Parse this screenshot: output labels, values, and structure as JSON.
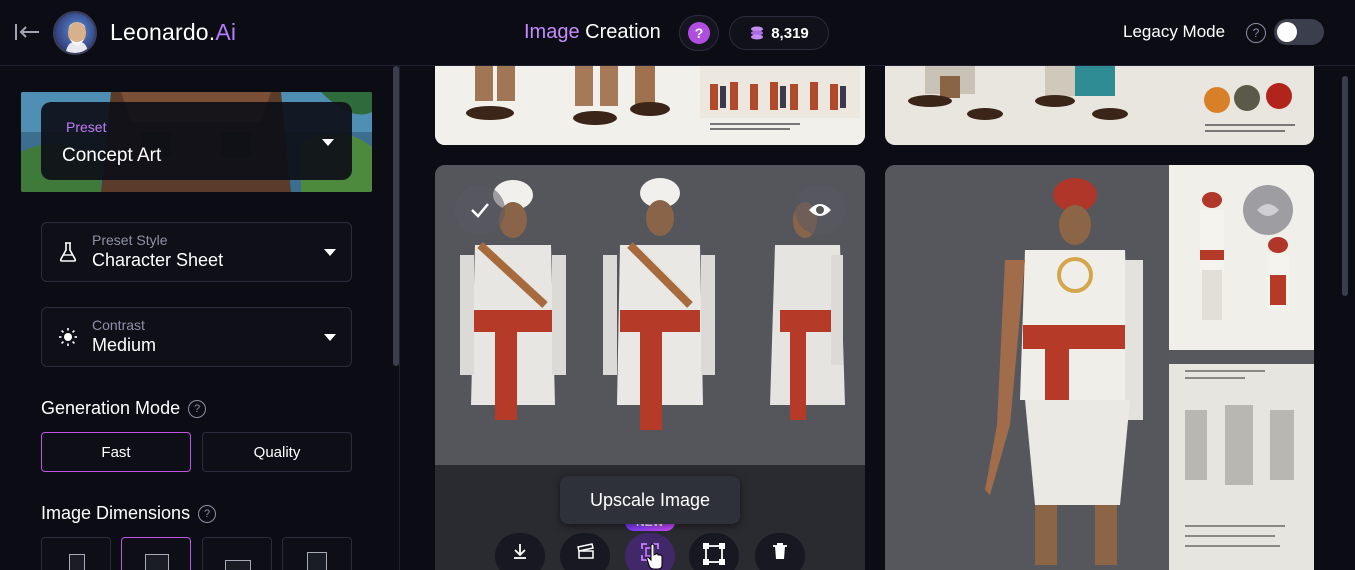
{
  "header": {
    "brand_name": "Leonardo.",
    "brand_suffix": "Ai",
    "page_title_prefix": "Image",
    "page_title_main": "Creation",
    "help_label": "?",
    "token_count": "8,319",
    "legacy_mode_label": "Legacy Mode",
    "legacy_mode_enabled": false,
    "legacy_help": "?"
  },
  "sidebar": {
    "preset": {
      "label": "Preset",
      "value": "Concept Art"
    },
    "preset_style": {
      "label": "Preset Style",
      "value": "Character Sheet",
      "icon": "flask-icon"
    },
    "contrast": {
      "label": "Contrast",
      "value": "Medium",
      "icon": "sun-icon"
    },
    "generation_mode": {
      "title": "Generation Mode",
      "help": "?",
      "options": [
        "Fast",
        "Quality"
      ],
      "selected": "Fast"
    },
    "image_dimensions": {
      "title": "Image Dimensions",
      "help": "?"
    }
  },
  "gallery": {
    "tooltip": "Upscale Image",
    "new_badge": "NEW",
    "actions": [
      {
        "name": "download-icon"
      },
      {
        "name": "film-icon"
      },
      {
        "name": "upscale-icon"
      },
      {
        "name": "crop-icon"
      },
      {
        "name": "trash-icon"
      }
    ]
  },
  "colors": {
    "accent": "#c056e3",
    "brand_purple": "#b57bff",
    "background": "#0c0d14"
  }
}
